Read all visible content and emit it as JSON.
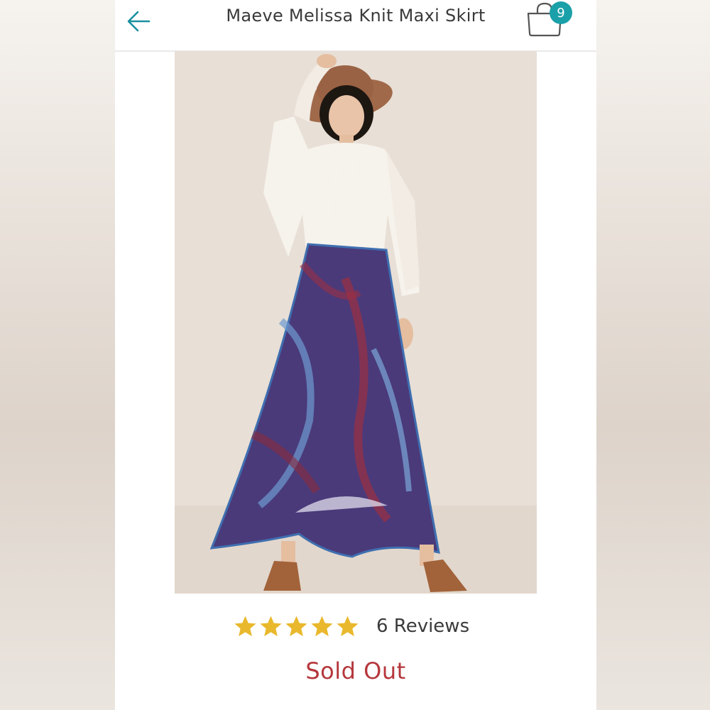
{
  "header": {
    "title": "Maeve Melissa Knit Maxi Skirt",
    "bag_count": "9"
  },
  "product": {
    "image_icon": "model-photo"
  },
  "rating": {
    "stars": 5,
    "max_stars": 5,
    "reviews_label": "6 Reviews"
  },
  "status": {
    "label": "Sold Out"
  },
  "colors": {
    "accent": "#1aa0a8",
    "star": "#e9b82c",
    "sold_out": "#b5373c"
  }
}
